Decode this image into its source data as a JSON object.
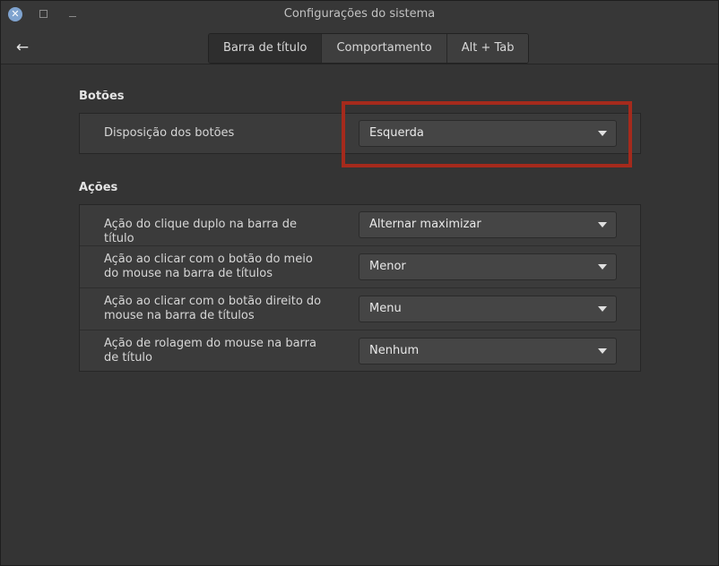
{
  "window": {
    "title": "Configurações do sistema",
    "close_glyph": "✕"
  },
  "header": {
    "back_glyph": "←",
    "tabs": [
      {
        "label": "Barra de título",
        "active": true
      },
      {
        "label": "Comportamento",
        "active": false
      },
      {
        "label": "Alt + Tab",
        "active": false
      }
    ]
  },
  "sections": {
    "buttons": {
      "title": "Botões",
      "rows": [
        {
          "label": "Disposição dos botões",
          "value": "Esquerda"
        }
      ]
    },
    "actions": {
      "title": "Ações",
      "rows": [
        {
          "label": "Ação do clique duplo na barra de título",
          "value": "Alternar maximizar"
        },
        {
          "label": "Ação ao clicar com o botão do meio do mouse na barra de títulos",
          "value": "Menor"
        },
        {
          "label": "Ação ao clicar com o botão direito do mouse na barra de títulos",
          "value": "Menu"
        },
        {
          "label": "Ação de rolagem do mouse na barra de título",
          "value": "Nenhum"
        }
      ]
    }
  },
  "colors": {
    "highlight": "#a52a1c",
    "close_button": "#7fa3cf"
  },
  "icons": {
    "close": "close-icon",
    "maximize": "maximize-icon",
    "minimize": "minimize-icon",
    "back": "back-arrow-icon",
    "dropdown": "chevron-down-icon"
  }
}
